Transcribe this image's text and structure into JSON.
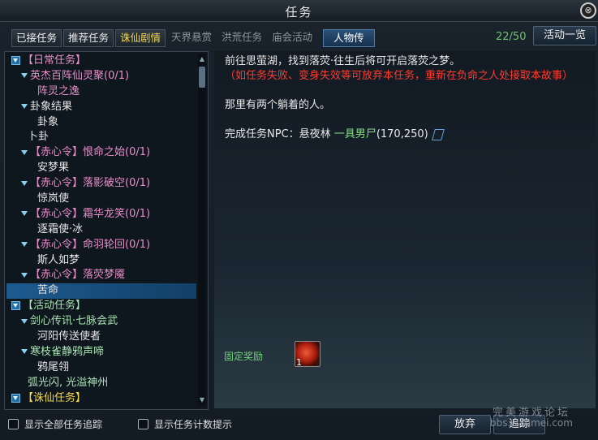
{
  "window": {
    "title": "任务"
  },
  "tabs": [
    {
      "label": "已接任务",
      "style": "on1"
    },
    {
      "label": "推荐任务",
      "style": "on2"
    },
    {
      "label": "诛仙剧情",
      "style": "gold"
    },
    {
      "label": "天界悬赏",
      "style": ""
    },
    {
      "label": "洪荒任务",
      "style": ""
    },
    {
      "label": "庙会活动",
      "style": ""
    },
    {
      "label": "人物传",
      "style": "active"
    }
  ],
  "quest_count": "22/50",
  "buttons": {
    "activity_list": "活动一览",
    "abandon": "放弃",
    "track": "追踪"
  },
  "tree": [
    {
      "label": "【日常任务】",
      "indent": 0,
      "color": "pink",
      "expand": true
    },
    {
      "label": "英杰百阵仙灵聚(0/1)",
      "indent": 1,
      "color": "pink",
      "expand": true
    },
    {
      "label": "阵灵之逸",
      "indent": 3,
      "color": "pink"
    },
    {
      "label": "卦象结果",
      "indent": 1,
      "color": "white",
      "expand": true
    },
    {
      "label": "卦象",
      "indent": 3,
      "color": "white"
    },
    {
      "label": "卜卦",
      "indent": 2,
      "color": "white"
    },
    {
      "label": "【赤心令】恨命之始(0/1)",
      "indent": 1,
      "color": "pink",
      "expand": true
    },
    {
      "label": "安梦果",
      "indent": 3,
      "color": "white"
    },
    {
      "label": "【赤心令】落影破空(0/1)",
      "indent": 1,
      "color": "pink",
      "expand": true
    },
    {
      "label": "惊岚使",
      "indent": 3,
      "color": "white"
    },
    {
      "label": "【赤心令】霜华龙笑(0/1)",
      "indent": 1,
      "color": "pink",
      "expand": true
    },
    {
      "label": "逐霜使·冰",
      "indent": 3,
      "color": "white"
    },
    {
      "label": "【赤心令】命羽轮回(0/1)",
      "indent": 1,
      "color": "pink",
      "expand": true
    },
    {
      "label": "斯人如梦",
      "indent": 3,
      "color": "white"
    },
    {
      "label": "【赤心令】落荧梦魇",
      "indent": 1,
      "color": "pink",
      "expand": true
    },
    {
      "label": "苦命",
      "indent": 3,
      "color": "white",
      "selected": true
    },
    {
      "label": "【活动任务】",
      "indent": 0,
      "color": "lgreen",
      "expand": true
    },
    {
      "label": "剑心传讯·七脉会武",
      "indent": 1,
      "color": "lgreen",
      "expand": true
    },
    {
      "label": "河阳传送使者",
      "indent": 3,
      "color": "white"
    },
    {
      "label": "寒枝雀静鸦声啼",
      "indent": 1,
      "color": "lgreen",
      "expand": true
    },
    {
      "label": "鸦尾翎",
      "indent": 3,
      "color": "white"
    },
    {
      "label": "弧光闪, 光溢神州",
      "indent": 2,
      "color": "lgreen"
    },
    {
      "label": "【诛仙任务】",
      "indent": 0,
      "color": "yellow",
      "expand": true
    }
  ],
  "detail": {
    "line1": "前往思萤湖，找到落荧·往生后将可开启落荧之梦。",
    "line2": "（如任务失败、变身失效等可放弃本任务，重新在负命之人处接取本故事）",
    "line3": "那里有两个躺着的人。",
    "npc_prefix": "完成任务NPC：悬夜林",
    "npc_name": "一具男尸",
    "npc_coord": "(170,250)"
  },
  "reward": {
    "label": "固定奖励",
    "qty": "1"
  },
  "options": {
    "show_all_tracking": "显示全部任务追踪",
    "show_count_hint": "显示任务计数提示"
  },
  "watermark": {
    "line1": "完美游戏论坛",
    "line2": "bbs.wanmei.com"
  }
}
